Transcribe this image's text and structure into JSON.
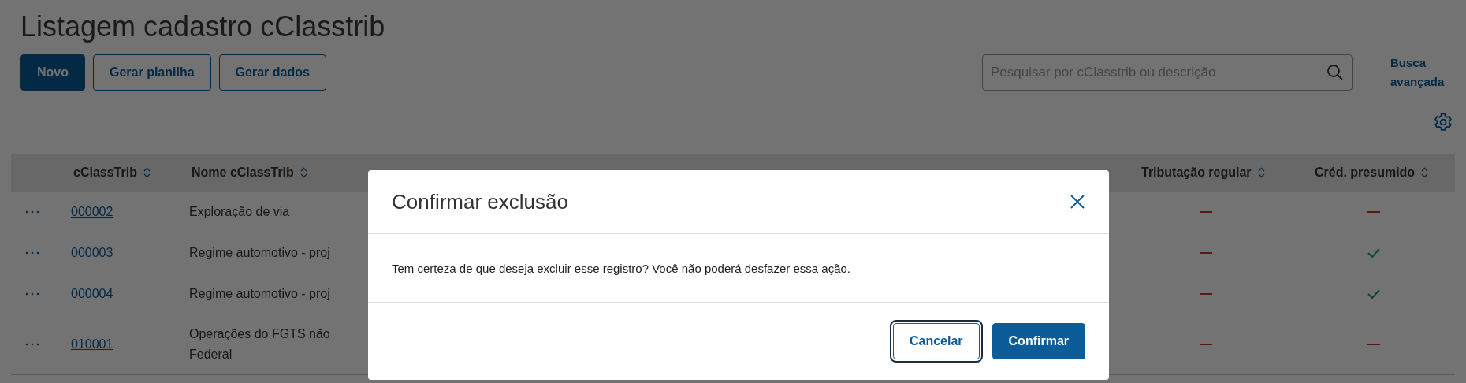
{
  "page": {
    "title": "Listagem cadastro cClasstrib"
  },
  "toolbar": {
    "buttons": [
      {
        "label": "Novo",
        "kind": "primary"
      },
      {
        "label": "Gerar planilha",
        "kind": "secondary"
      },
      {
        "label": "Gerar dados",
        "kind": "secondary"
      }
    ],
    "search": {
      "placeholder": "Pesquisar por cClasstrib ou descrição"
    },
    "advanced_search": "Busca avançada"
  },
  "table": {
    "columns": [
      "cClassTrib",
      "Nome cClassTrib",
      "Tributação regular",
      "Créd. presumido"
    ],
    "rows": [
      {
        "code": "000002",
        "name": "Exploração de via",
        "tributacao_regular": false,
        "credito_presumido": false
      },
      {
        "code": "000003",
        "name": "Regime automotivo - proj",
        "tributacao_regular": false,
        "credito_presumido": true
      },
      {
        "code": "000004",
        "name": "Regime automotivo - proj",
        "tributacao_regular": false,
        "credito_presumido": true
      },
      {
        "code": "010001",
        "name": "Operações do FGTS não\nFederal",
        "tributacao_regular": false,
        "credito_presumido": false
      }
    ]
  },
  "dialog": {
    "title": "Confirmar exclusão",
    "message": "Tem certeza de que deseja excluir esse registro? Você não poderá desfazer essa ação.",
    "buttons": [
      {
        "label": "Cancelar",
        "kind": "secondary",
        "focused": true
      },
      {
        "label": "Confirmar",
        "kind": "primary",
        "focused": false
      }
    ]
  }
}
